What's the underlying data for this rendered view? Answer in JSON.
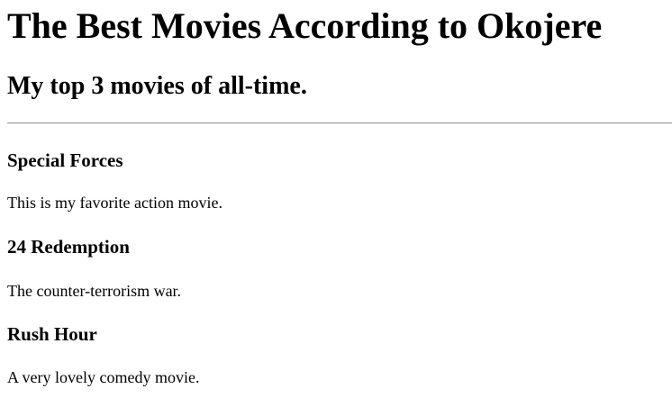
{
  "page": {
    "title": "The Best Movies According to Okojere",
    "subtitle": "My top 3 movies of all-time."
  },
  "movies": [
    {
      "title": "Special Forces",
      "description": "This is my favorite action movie."
    },
    {
      "title": "24 Redemption",
      "description": "The counter-terrorism war."
    },
    {
      "title": "Rush Hour",
      "description": "A very lovely comedy movie."
    }
  ]
}
